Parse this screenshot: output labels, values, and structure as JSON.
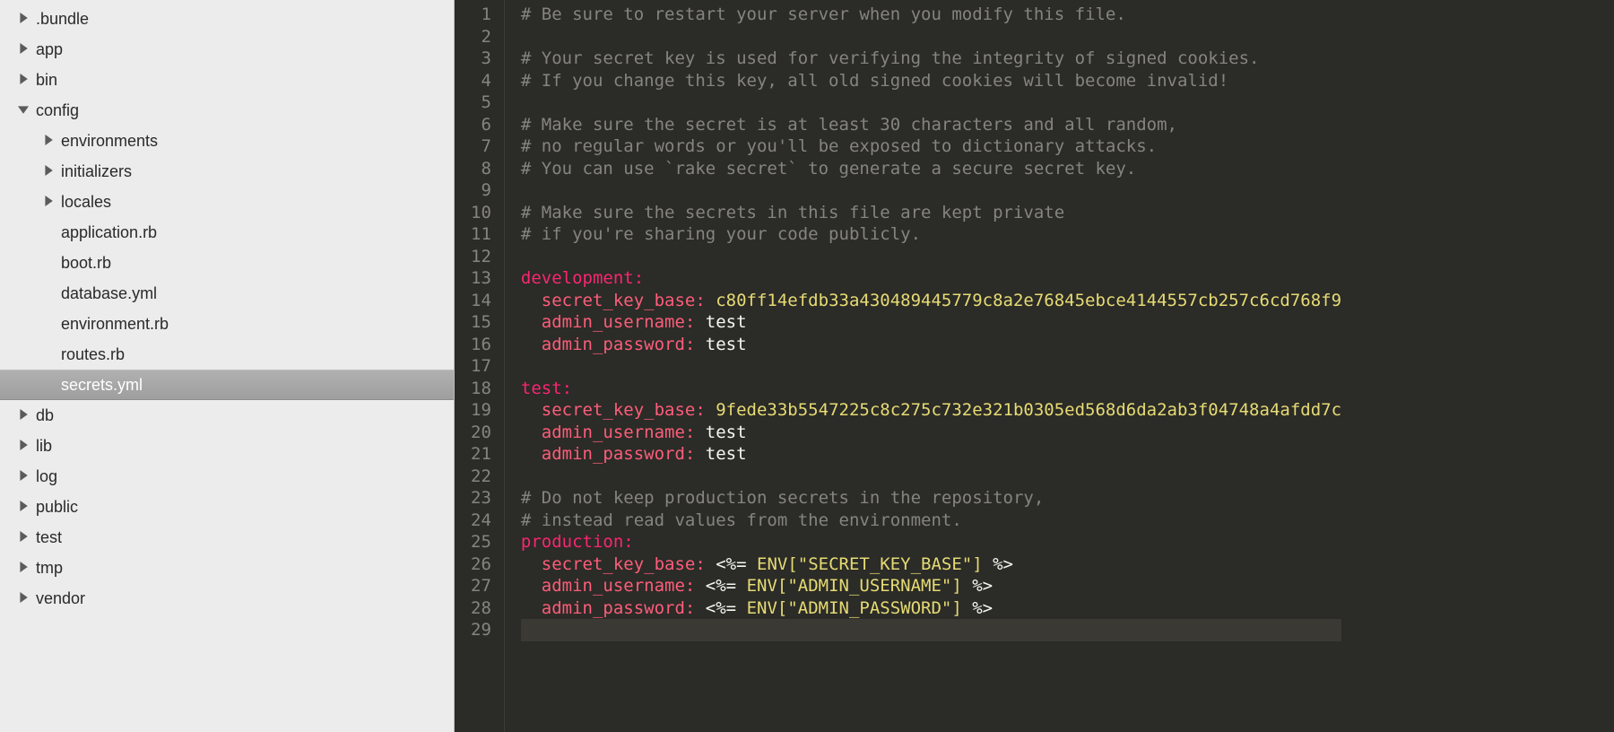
{
  "tree": [
    {
      "label": ".bundle",
      "depth": 0,
      "arrow": "right",
      "selected": false
    },
    {
      "label": "app",
      "depth": 0,
      "arrow": "right",
      "selected": false
    },
    {
      "label": "bin",
      "depth": 0,
      "arrow": "right",
      "selected": false
    },
    {
      "label": "config",
      "depth": 0,
      "arrow": "down",
      "selected": false
    },
    {
      "label": "environments",
      "depth": 1,
      "arrow": "right",
      "selected": false
    },
    {
      "label": "initializers",
      "depth": 1,
      "arrow": "right",
      "selected": false
    },
    {
      "label": "locales",
      "depth": 1,
      "arrow": "right",
      "selected": false
    },
    {
      "label": "application.rb",
      "depth": 1,
      "arrow": "",
      "selected": false
    },
    {
      "label": "boot.rb",
      "depth": 1,
      "arrow": "",
      "selected": false
    },
    {
      "label": "database.yml",
      "depth": 1,
      "arrow": "",
      "selected": false
    },
    {
      "label": "environment.rb",
      "depth": 1,
      "arrow": "",
      "selected": false
    },
    {
      "label": "routes.rb",
      "depth": 1,
      "arrow": "",
      "selected": false
    },
    {
      "label": "secrets.yml",
      "depth": 1,
      "arrow": "",
      "selected": true
    },
    {
      "label": "db",
      "depth": 0,
      "arrow": "right",
      "selected": false
    },
    {
      "label": "lib",
      "depth": 0,
      "arrow": "right",
      "selected": false
    },
    {
      "label": "log",
      "depth": 0,
      "arrow": "right",
      "selected": false
    },
    {
      "label": "public",
      "depth": 0,
      "arrow": "right",
      "selected": false
    },
    {
      "label": "test",
      "depth": 0,
      "arrow": "right",
      "selected": false
    },
    {
      "label": "tmp",
      "depth": 0,
      "arrow": "right",
      "selected": false
    },
    {
      "label": "vendor",
      "depth": 0,
      "arrow": "right",
      "selected": false
    }
  ],
  "code": [
    {
      "n": 1,
      "spans": [
        {
          "cls": "c-comment",
          "t": "# Be sure to restart your server when you modify this file."
        }
      ]
    },
    {
      "n": 2,
      "spans": [
        {
          "cls": "c-plain",
          "t": ""
        }
      ]
    },
    {
      "n": 3,
      "spans": [
        {
          "cls": "c-comment",
          "t": "# Your secret key is used for verifying the integrity of signed cookies."
        }
      ]
    },
    {
      "n": 4,
      "spans": [
        {
          "cls": "c-comment",
          "t": "# If you change this key, all old signed cookies will become invalid!"
        }
      ]
    },
    {
      "n": 5,
      "spans": [
        {
          "cls": "c-plain",
          "t": ""
        }
      ]
    },
    {
      "n": 6,
      "spans": [
        {
          "cls": "c-comment",
          "t": "# Make sure the secret is at least 30 characters and all random,"
        }
      ]
    },
    {
      "n": 7,
      "spans": [
        {
          "cls": "c-comment",
          "t": "# no regular words or you'll be exposed to dictionary attacks."
        }
      ]
    },
    {
      "n": 8,
      "spans": [
        {
          "cls": "c-comment",
          "t": "# You can use `rake secret` to generate a secure secret key."
        }
      ]
    },
    {
      "n": 9,
      "spans": [
        {
          "cls": "c-plain",
          "t": ""
        }
      ]
    },
    {
      "n": 10,
      "spans": [
        {
          "cls": "c-comment",
          "t": "# Make sure the secrets in this file are kept private"
        }
      ]
    },
    {
      "n": 11,
      "spans": [
        {
          "cls": "c-comment",
          "t": "# if you're sharing your code publicly."
        }
      ]
    },
    {
      "n": 12,
      "spans": [
        {
          "cls": "c-plain",
          "t": ""
        }
      ]
    },
    {
      "n": 13,
      "spans": [
        {
          "cls": "c-key1",
          "t": "development:"
        }
      ]
    },
    {
      "n": 14,
      "spans": [
        {
          "cls": "c-key2",
          "t": "  secret_key_base:"
        },
        {
          "cls": "c-val",
          "t": " c80ff14efdb33a430489445779c8a2e76845ebce4144557cb257c6cd768f9"
        }
      ]
    },
    {
      "n": 15,
      "spans": [
        {
          "cls": "c-key2",
          "t": "  admin_username:"
        },
        {
          "cls": "c-plain",
          "t": " test"
        }
      ]
    },
    {
      "n": 16,
      "spans": [
        {
          "cls": "c-key2",
          "t": "  admin_password:"
        },
        {
          "cls": "c-plain",
          "t": " test"
        }
      ]
    },
    {
      "n": 17,
      "spans": [
        {
          "cls": "c-plain",
          "t": ""
        }
      ]
    },
    {
      "n": 18,
      "spans": [
        {
          "cls": "c-key1",
          "t": "test:"
        }
      ]
    },
    {
      "n": 19,
      "spans": [
        {
          "cls": "c-key2",
          "t": "  secret_key_base:"
        },
        {
          "cls": "c-val",
          "t": " 9fede33b5547225c8c275c732e321b0305ed568d6da2ab3f04748a4afdd7c"
        }
      ]
    },
    {
      "n": 20,
      "spans": [
        {
          "cls": "c-key2",
          "t": "  admin_username:"
        },
        {
          "cls": "c-plain",
          "t": " test"
        }
      ]
    },
    {
      "n": 21,
      "spans": [
        {
          "cls": "c-key2",
          "t": "  admin_password:"
        },
        {
          "cls": "c-plain",
          "t": " test"
        }
      ]
    },
    {
      "n": 22,
      "spans": [
        {
          "cls": "c-plain",
          "t": ""
        }
      ]
    },
    {
      "n": 23,
      "spans": [
        {
          "cls": "c-comment",
          "t": "# Do not keep production secrets in the repository,"
        }
      ]
    },
    {
      "n": 24,
      "spans": [
        {
          "cls": "c-comment",
          "t": "# instead read values from the environment."
        }
      ]
    },
    {
      "n": 25,
      "spans": [
        {
          "cls": "c-key1",
          "t": "production:"
        }
      ]
    },
    {
      "n": 26,
      "spans": [
        {
          "cls": "c-key2",
          "t": "  secret_key_base:"
        },
        {
          "cls": "c-plain",
          "t": " <%= "
        },
        {
          "cls": "c-val",
          "t": "ENV[\"SECRET_KEY_BASE\"]"
        },
        {
          "cls": "c-plain",
          "t": " %>"
        }
      ]
    },
    {
      "n": 27,
      "spans": [
        {
          "cls": "c-key2",
          "t": "  admin_username:"
        },
        {
          "cls": "c-plain",
          "t": " <%= "
        },
        {
          "cls": "c-val",
          "t": "ENV[\"ADMIN_USERNAME\"]"
        },
        {
          "cls": "c-plain",
          "t": " %>"
        }
      ]
    },
    {
      "n": 28,
      "spans": [
        {
          "cls": "c-key2",
          "t": "  admin_password:"
        },
        {
          "cls": "c-plain",
          "t": " <%= "
        },
        {
          "cls": "c-val",
          "t": "ENV[\"ADMIN_PASSWORD\"]"
        },
        {
          "cls": "c-plain",
          "t": " %>"
        }
      ]
    },
    {
      "n": 29,
      "spans": [
        {
          "cls": "c-plain",
          "t": ""
        }
      ],
      "last": true
    }
  ]
}
